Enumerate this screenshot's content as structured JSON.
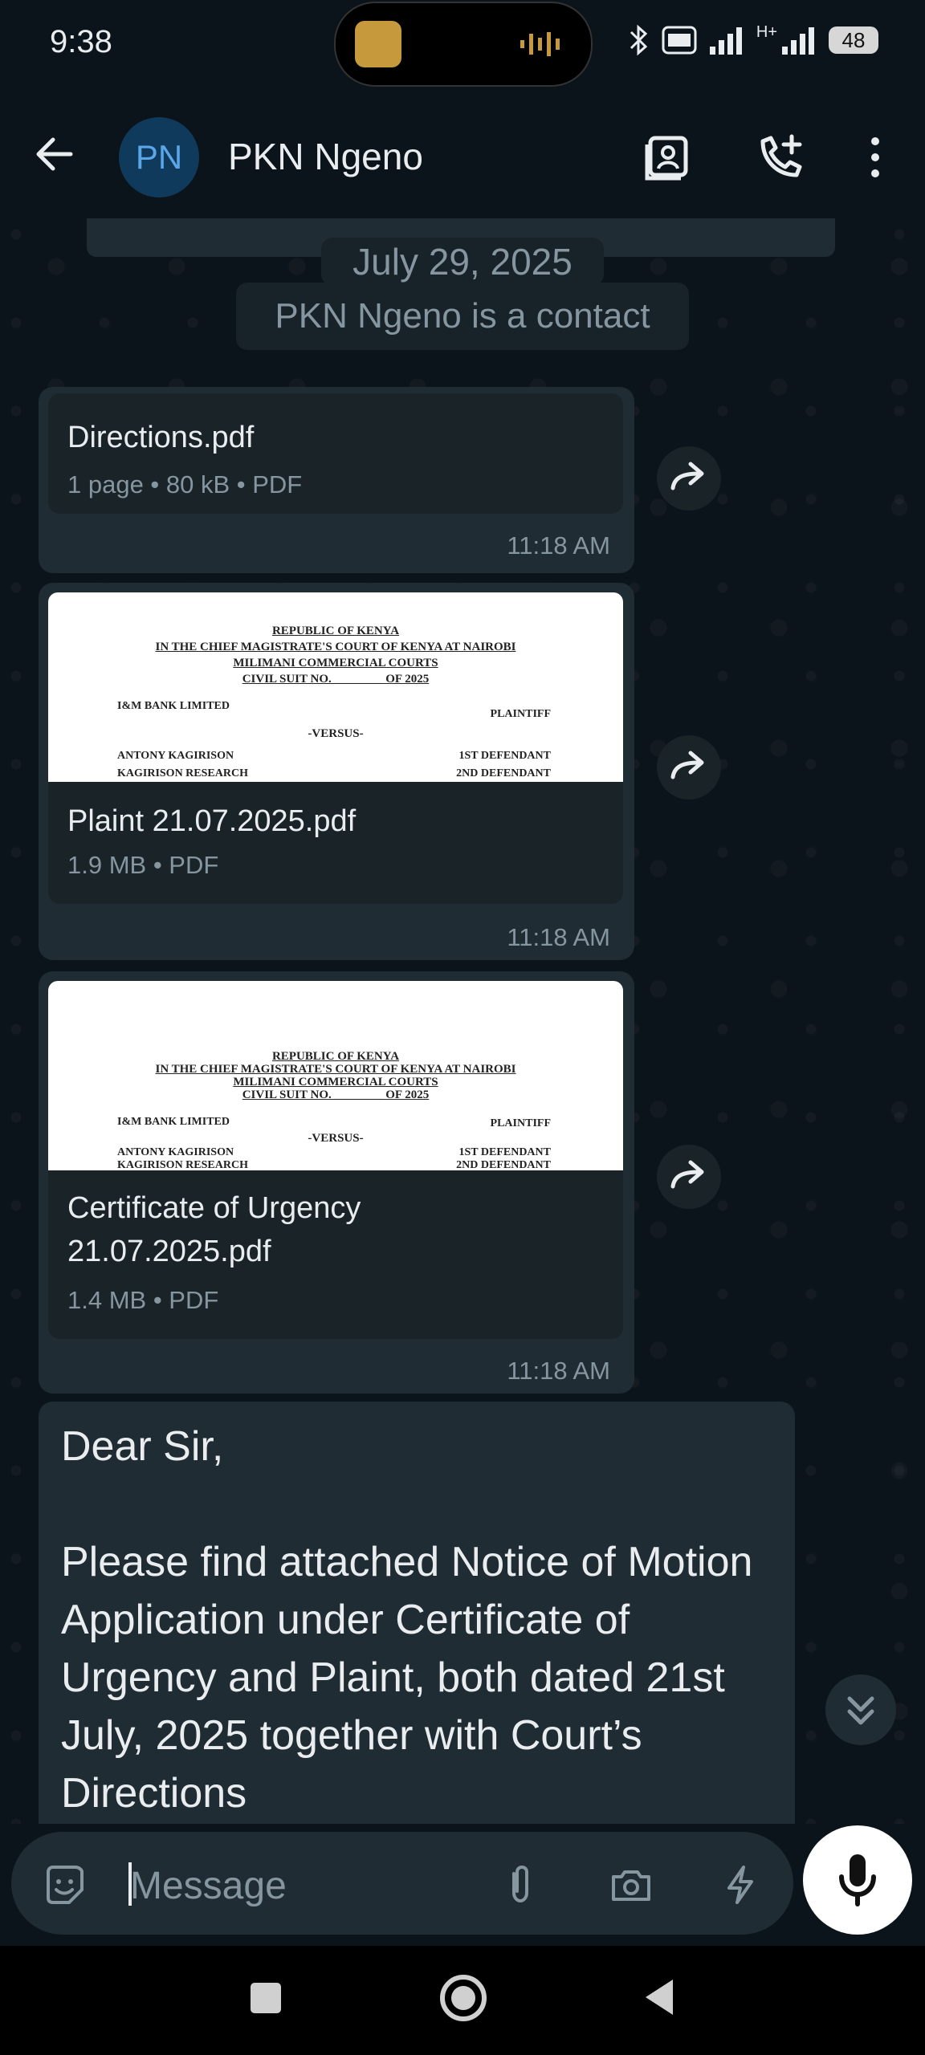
{
  "status": {
    "time": "9:38",
    "battery": "48",
    "network": "H+"
  },
  "header": {
    "avatar_initials": "PN",
    "contact_name": "PKN Ngeno"
  },
  "chat": {
    "date": "July 29, 2025",
    "contact_info": "PKN Ngeno is a contact",
    "messages": [
      {
        "file_name": "Directions.pdf",
        "meta": "1 page • 80 kB • PDF",
        "time": "11:18 AM"
      },
      {
        "file_name": "Plaint 21.07.2025.pdf",
        "meta": "1.9 MB • PDF",
        "time": "11:18 AM"
      },
      {
        "file_name": "Certificate of Urgency 21.07.2025.pdf",
        "meta": "1.4 MB • PDF",
        "time": "11:18 AM"
      }
    ],
    "text_message": {
      "line1": "Dear Sir,",
      "body": "Please find attached Notice of Motion Application under Certificate of Urgency and Plaint, both dated 21st July, 2025 together with Court’s Directions"
    }
  },
  "preview_doc": {
    "republic": "REPUBLIC OF KENYA",
    "court": "IN THE CHIEF MAGISTRATE'S COURT OF KENYA AT NAIROBI",
    "division": "MILIMANI COMMERCIAL COURTS",
    "suit": "CIVIL SUIT NO. ________ OF 2025",
    "plaintiff": "I&M BANK LIMITED",
    "plaintiff_role": "PLAINTIFF",
    "versus": "-VERSUS-",
    "defendant1": "ANTONY KAGIRISON",
    "defendant1_role": "1ST DEFENDANT",
    "defendant2": "KAGIRISON RESEARCH",
    "defendant2_role": "2ND DEFENDANT"
  },
  "composer": {
    "placeholder": "Message"
  }
}
